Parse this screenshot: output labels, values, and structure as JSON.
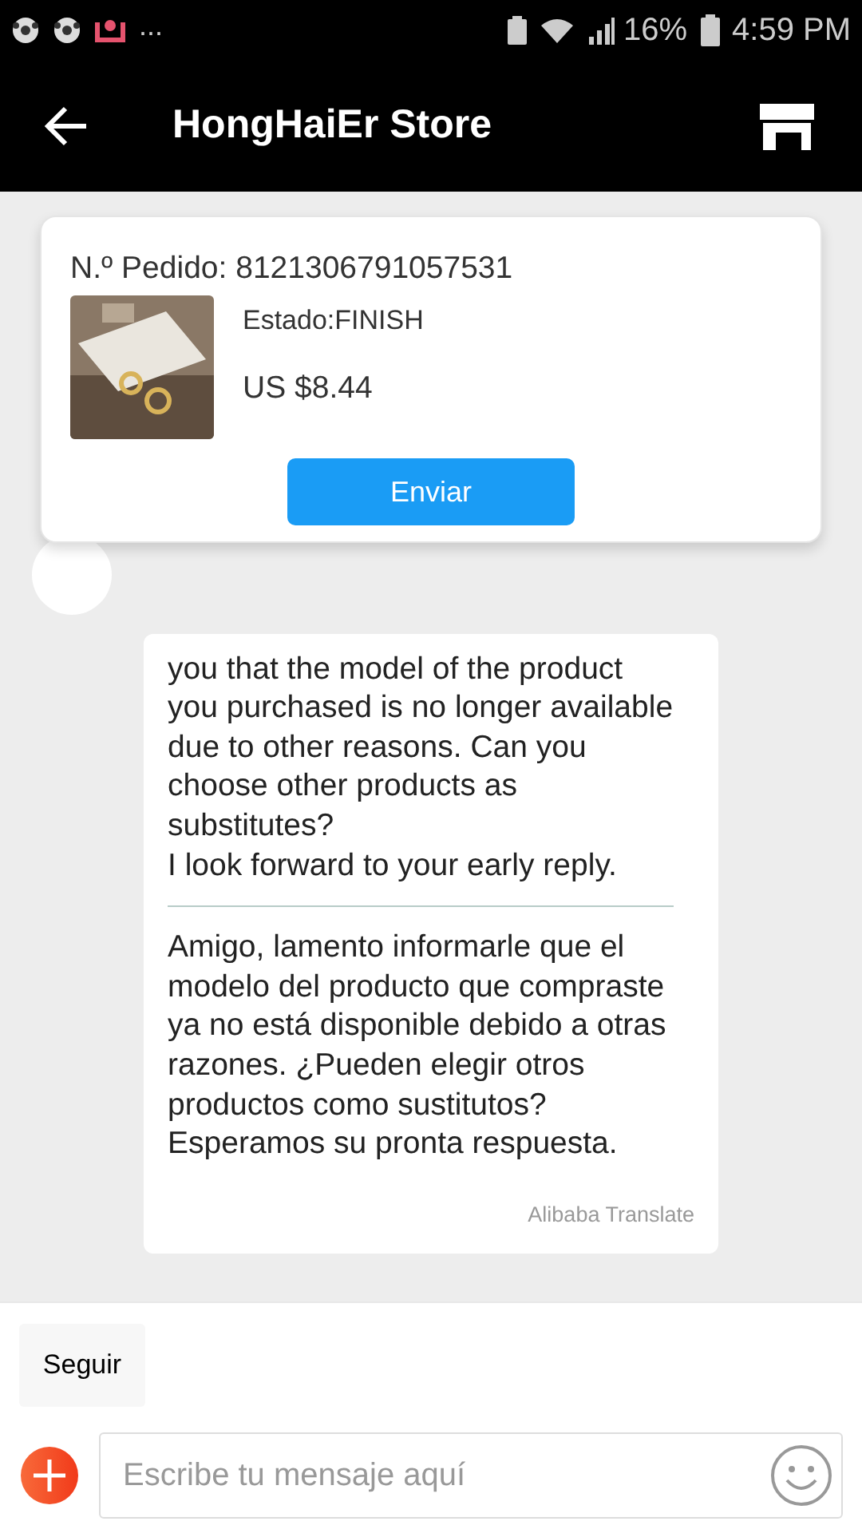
{
  "status_bar": {
    "overflow": "...",
    "battery": "16%",
    "time": "4:59 PM"
  },
  "header": {
    "title": "HongHaiEr Store"
  },
  "order_card": {
    "order_number": "N.º Pedido: 8121306791057531",
    "status": "Estado:FINISH",
    "price": "US $8.44",
    "button": "Enviar"
  },
  "message": {
    "original": "you that the model of the product you purchased is no longer available due to other reasons. Can you choose other products as substitutes?\nI look forward to your early reply.",
    "translation": "Amigo, lamento informarle que el modelo del producto que compraste ya no está disponible debido a otras razones. ¿Pueden elegir otros productos como sustitutos?\nEsperamos su pronta respuesta.",
    "credit": "Alibaba Translate"
  },
  "quick_reply": "Seguir",
  "composer": {
    "placeholder": "Escribe tu mensaje aquí"
  }
}
